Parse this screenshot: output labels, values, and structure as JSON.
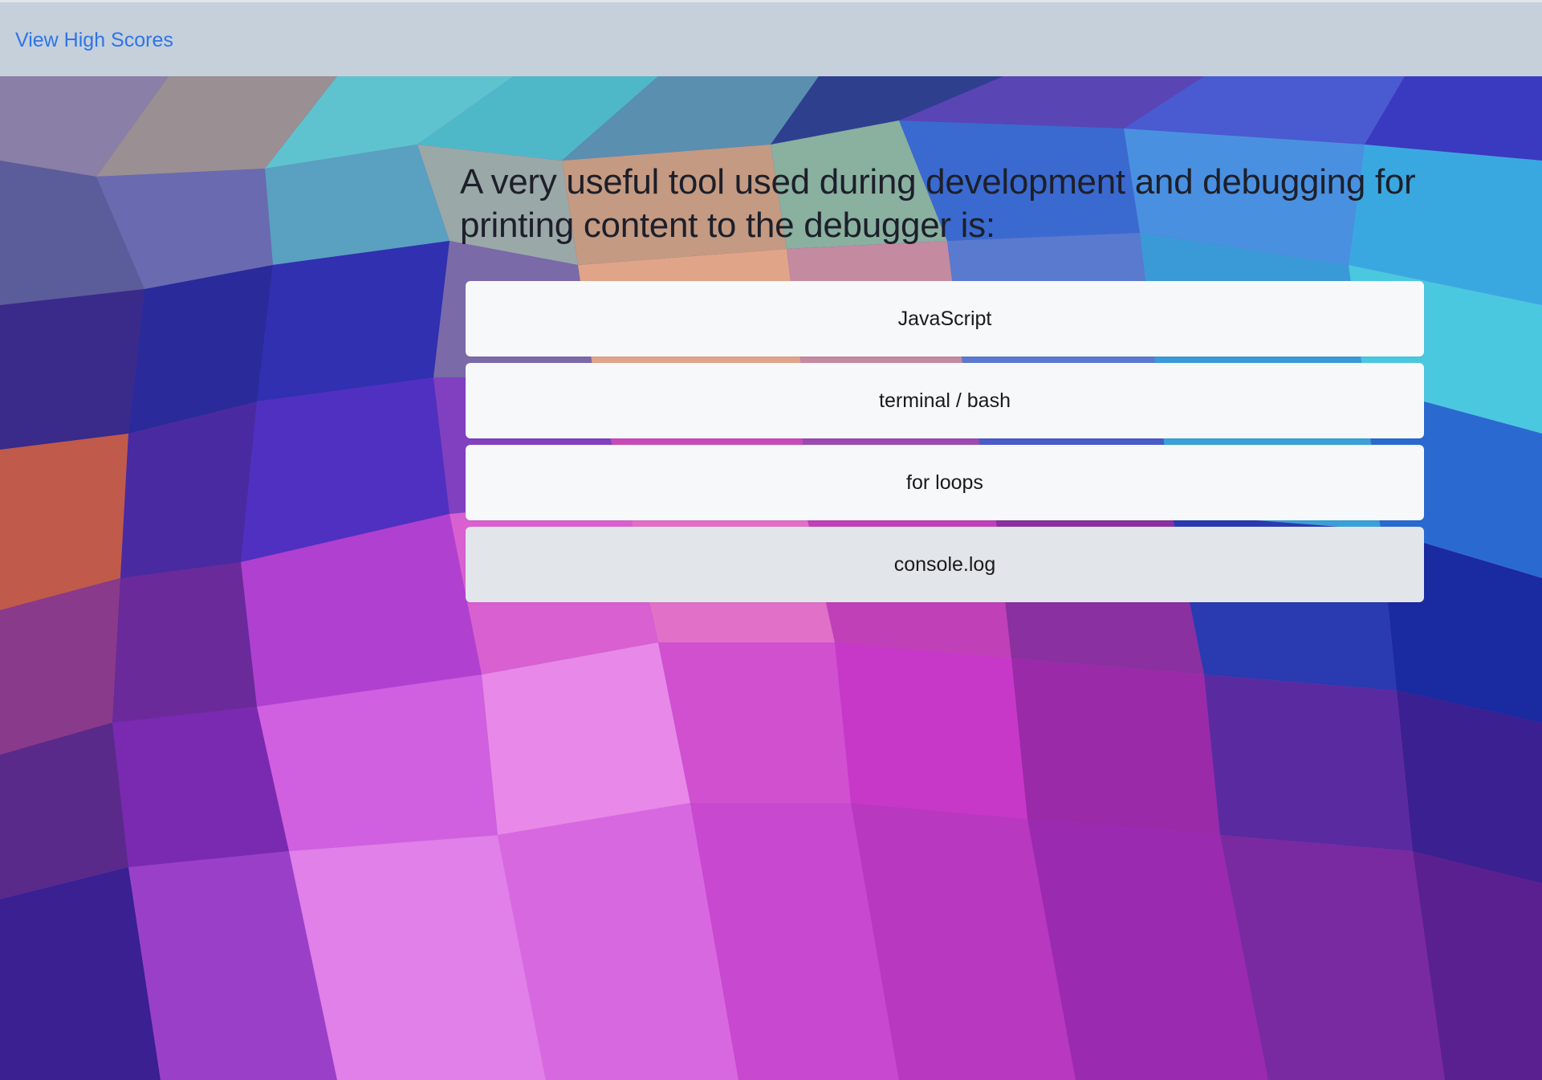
{
  "nav": {
    "high_scores_label": "View High Scores"
  },
  "quiz": {
    "question": "A very useful tool used during development and debugging for printing content to the debugger is:",
    "choices": [
      {
        "label": "JavaScript"
      },
      {
        "label": "terminal / bash"
      },
      {
        "label": "for loops"
      },
      {
        "label": "console.log",
        "hovered": true
      }
    ]
  },
  "colors": {
    "topbar_bg": "#c5d0db",
    "link": "#2f74e8",
    "choice_bg": "#f7f8fa",
    "choice_hover_bg": "#e2e5e9",
    "question_text": "#1d1f2a"
  }
}
